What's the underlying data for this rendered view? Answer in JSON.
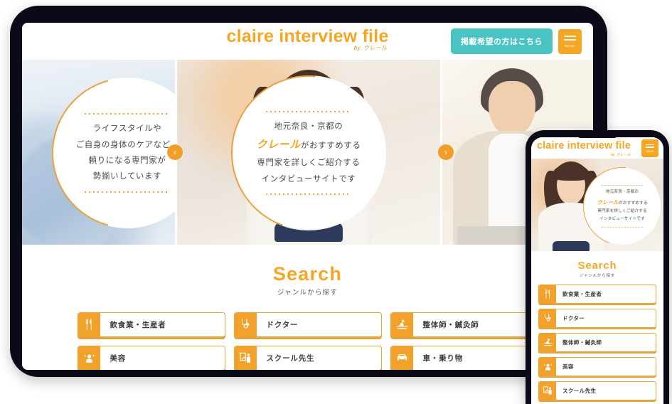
{
  "header": {
    "logo_main": "claire interview file",
    "logo_sub": "by. クレール",
    "cta_label": "掲載希望の方はこちら",
    "menu_label": "MENU"
  },
  "hero": {
    "prev_label": "‹",
    "next_label": "›",
    "slides": [
      {
        "id": "lifestyle",
        "lines": [
          "ライフスタイルや",
          "ご自身の身体のケアなど、",
          "頼りになる専門家が",
          "勢揃いしています"
        ]
      },
      {
        "id": "intro",
        "line1": "地元奈良・京都の",
        "brand": "クレール",
        "line2_suffix": "がおすすめする",
        "line3": "専門家を詳しくご紹介する",
        "line4": "インタビューサイトです"
      }
    ]
  },
  "search": {
    "title": "Search",
    "subtitle": "ジャンルから探す",
    "categories": [
      {
        "label": "飲食業・生産者",
        "icon": "fork-knife-icon"
      },
      {
        "label": "ドクター",
        "icon": "stethoscope-icon"
      },
      {
        "label": "整体師・鍼灸師",
        "icon": "massage-icon"
      },
      {
        "label": "美容",
        "icon": "beauty-icon"
      },
      {
        "label": "スクール先生",
        "icon": "teacher-icon"
      },
      {
        "label": "車・乗り物",
        "icon": "car-icon"
      }
    ]
  },
  "colors": {
    "brand_orange": "#F5A623",
    "icon_orange": "#F2A22A",
    "cta_teal": "#4BC3C3",
    "bezel": "#0a0a18",
    "text_dark": "#3c3c3c"
  }
}
